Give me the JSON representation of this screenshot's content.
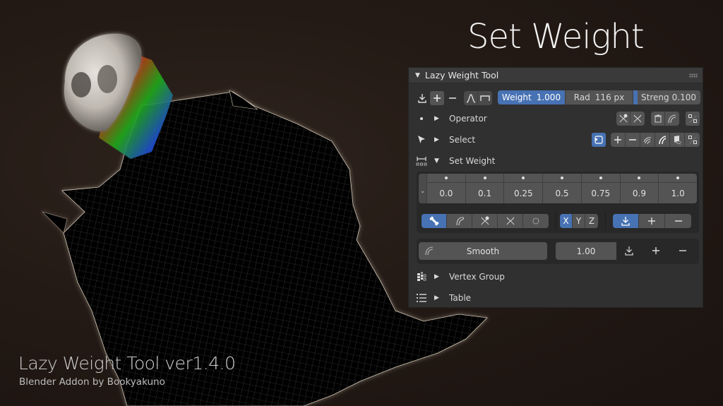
{
  "hero": {
    "title": "Set Weight"
  },
  "footer": {
    "title": "Lazy Weight Tool ver1.4.0",
    "subtitle": "Blender Addon by Bookyakuno"
  },
  "panel": {
    "title": "Lazy Weight Tool",
    "toolbar": {
      "brush_icons": [
        "apply-icon",
        "add-icon",
        "subtract-icon"
      ],
      "falloff_icons": [
        "smooth-falloff-icon",
        "constant-falloff-icon"
      ],
      "weight_label": "Weight",
      "weight_value": "1.000",
      "radius_label": "Rad",
      "radius_value": "116 px",
      "strength_label": "Streng",
      "strength_value": "0.100",
      "weight_fill": 1.0,
      "strength_fill": 0.1
    },
    "sections": {
      "operator": {
        "label": "Operator",
        "expanded": false
      },
      "select": {
        "label": "Select",
        "expanded": false
      },
      "set_weight": {
        "label": "Set Weight",
        "expanded": true
      },
      "vertex_group": {
        "label": "Vertex Group",
        "expanded": false
      },
      "table": {
        "label": "Table",
        "expanded": false
      }
    },
    "presets": [
      "0.0",
      "0.1",
      "0.25",
      "0.5",
      "0.75",
      "0.9",
      "1.0"
    ],
    "target_modes": [
      {
        "icon": "bone-icon",
        "active": true
      },
      {
        "icon": "curve-icon",
        "active": false
      },
      {
        "icon": "add-vertex-group-icon",
        "active": false
      },
      {
        "icon": "vertex-group-icon",
        "active": false
      },
      {
        "icon": "circle-icon",
        "active": false
      }
    ],
    "axes": [
      {
        "label": "X",
        "active": true
      },
      {
        "label": "Y",
        "active": false
      },
      {
        "label": "Z",
        "active": false
      }
    ],
    "blend_modes": [
      {
        "icon": "replace-icon",
        "active": true
      },
      {
        "icon": "add-icon",
        "active": false
      },
      {
        "icon": "subtract-icon",
        "active": false
      }
    ],
    "smooth": {
      "label": "Smooth",
      "value": "1.00"
    }
  },
  "colors": {
    "accent": "#4772b3",
    "panel_bg": "#303030",
    "button": "#545454",
    "background": "#241a15"
  }
}
